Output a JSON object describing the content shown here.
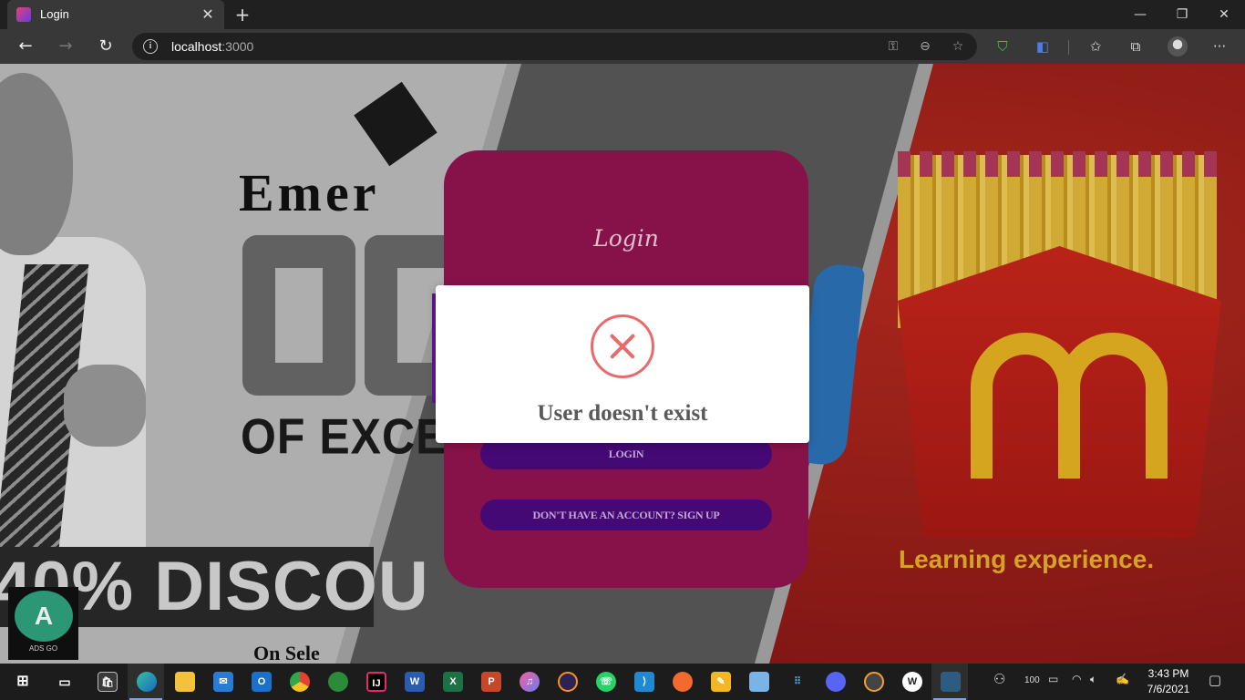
{
  "browser": {
    "tab_title": "Login",
    "tab_close": "✕",
    "new_tab": "+",
    "window": {
      "minimize": "—",
      "restore": "❐",
      "close": "✕"
    },
    "nav": {
      "back": "←",
      "forward": "→",
      "refresh": "↻"
    },
    "address_host": "localhost",
    "address_port": ":3000",
    "more": "···"
  },
  "page": {
    "left_ad": {
      "brand": "Emer",
      "big_text": "06",
      "excellence": "OF EXCE",
      "discount": "40% DISCOU",
      "on_sale": "On Sele",
      "badge_logo": "A",
      "badge_text": "ADS GO"
    },
    "right_ad": {
      "tagline": "Learning experience."
    },
    "login_card": {
      "title": "Login",
      "login_button": "LOGIN",
      "signup_button": "DON'T HAVE AN ACCOUNT? SIGN UP"
    },
    "modal": {
      "icon": "error-x",
      "message": "User doesn't exist",
      "accent_color": "#e86a6a"
    }
  },
  "taskbar": {
    "apps": [
      "start",
      "task-view",
      "store",
      "edge",
      "file-explorer",
      "mail",
      "outlook",
      "chrome",
      "git",
      "intellij",
      "word",
      "excel",
      "powerpoint",
      "itunes",
      "eclipse",
      "whatsapp",
      "vscode",
      "brave",
      "sketch",
      "virtualbox",
      "anaconda",
      "discord",
      "media",
      "wordpress",
      "mysql-workbench"
    ],
    "battery_label": "100",
    "time": "3:43 PM",
    "date": "7/6/2021"
  }
}
